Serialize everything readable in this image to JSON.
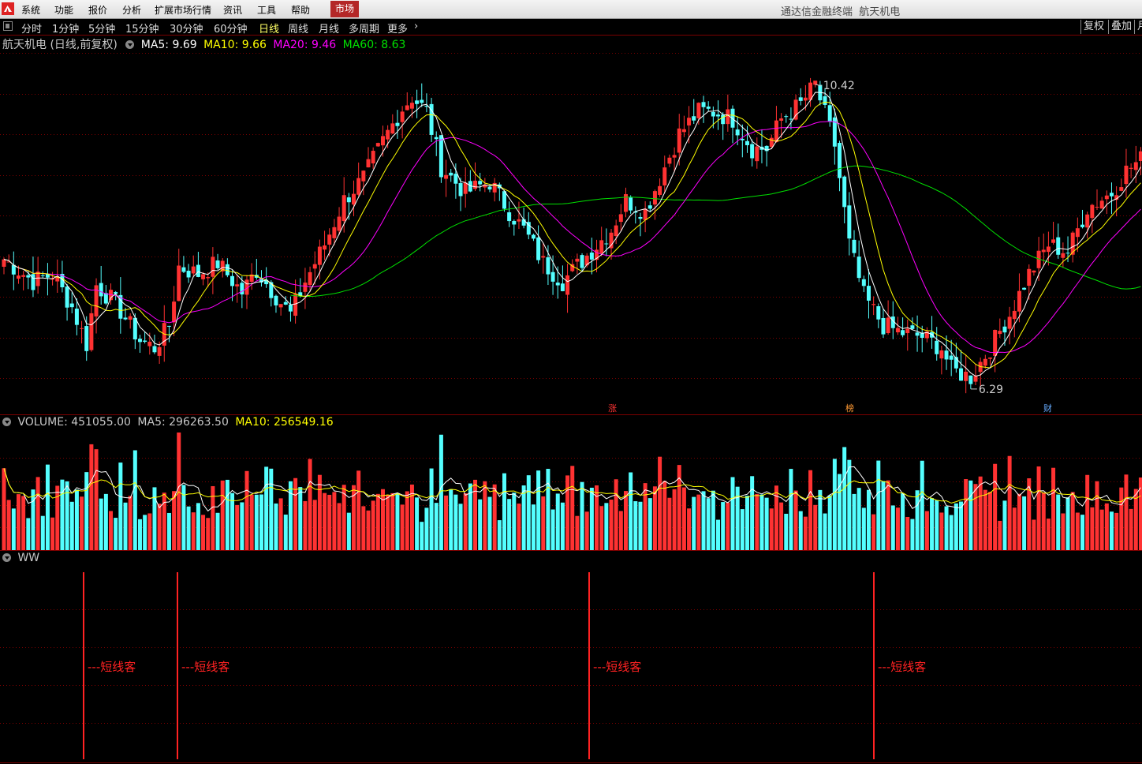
{
  "window": {
    "title": "通达信金融终端",
    "stock_name": "航天机电"
  },
  "menu": {
    "items": [
      "系统",
      "功能",
      "报价",
      "分析",
      "扩展市场行情",
      "资讯",
      "工具",
      "帮助"
    ],
    "active": "市场"
  },
  "period_tabs": {
    "items": [
      "分时",
      "1分钟",
      "5分钟",
      "15分钟",
      "30分钟",
      "60分钟",
      "日线",
      "周线",
      "月线",
      "多周期",
      "更多"
    ],
    "active_index": 6,
    "more_arrow": "›"
  },
  "right_buttons": {
    "items": [
      "复权",
      "叠加",
      "月"
    ]
  },
  "price_panel": {
    "title": "航天机电 (日线,前复权)",
    "ma_labels": [
      {
        "label": "MA5: 9.69",
        "color": "#ffffff"
      },
      {
        "label": "MA10: 9.66",
        "color": "#ffff00"
      },
      {
        "label": "MA20: 9.46",
        "color": "#ff00ff"
      },
      {
        "label": "MA60: 8.63",
        "color": "#00e000"
      }
    ],
    "high_label": "10.42",
    "low_label": "6.29",
    "event_flags": [
      {
        "label": "涨",
        "color": "#ff3333"
      },
      {
        "label": "榜",
        "color": "#ff9933"
      },
      {
        "label": "财",
        "color": "#66aaff"
      }
    ]
  },
  "volume_panel": {
    "labels": [
      {
        "label": "VOLUME: 451055.00",
        "color": "#c8c8c8"
      },
      {
        "label": "MA5: 296263.50",
        "color": "#c8c8c8"
      },
      {
        "label": "MA10: 256549.16",
        "color": "#ffff00"
      }
    ]
  },
  "ww_panel": {
    "label": "WW",
    "signal_text": "---短线客",
    "signal_count": 4
  },
  "colors": {
    "up": "#ff3232",
    "down": "#54ffff",
    "grid": "#7a0000",
    "ma5": "#ffffff",
    "ma10": "#ffff00",
    "ma20": "#ff00ff",
    "ma60": "#00e000"
  },
  "chart_data": {
    "type": "candlestick",
    "series_anchors_close": [
      [
        0,
        8.05
      ],
      [
        6,
        7.75
      ],
      [
        10,
        7.85
      ],
      [
        14,
        7.4
      ],
      [
        17,
        6.9
      ],
      [
        19,
        7.7
      ],
      [
        23,
        7.45
      ],
      [
        28,
        6.95
      ],
      [
        31,
        6.85
      ],
      [
        34,
        7.15
      ],
      [
        36,
        7.95
      ],
      [
        40,
        7.85
      ],
      [
        44,
        8.0
      ],
      [
        49,
        7.6
      ],
      [
        52,
        7.9
      ],
      [
        56,
        7.55
      ],
      [
        59,
        7.3
      ],
      [
        62,
        7.75
      ],
      [
        66,
        8.25
      ],
      [
        70,
        8.85
      ],
      [
        74,
        9.15
      ],
      [
        78,
        9.65
      ],
      [
        82,
        10.1
      ],
      [
        84,
        10.25
      ],
      [
        87,
        10.05
      ],
      [
        90,
        9.3
      ],
      [
        95,
        8.95
      ],
      [
        100,
        9.1
      ],
      [
        104,
        8.7
      ],
      [
        107,
        8.45
      ],
      [
        111,
        8.0
      ],
      [
        115,
        7.75
      ],
      [
        120,
        8.1
      ],
      [
        125,
        8.45
      ],
      [
        128,
        8.85
      ],
      [
        132,
        8.7
      ],
      [
        136,
        9.3
      ],
      [
        139,
        9.75
      ],
      [
        143,
        10.05
      ],
      [
        146,
        10.05
      ],
      [
        150,
        9.95
      ],
      [
        154,
        9.55
      ],
      [
        157,
        9.55
      ],
      [
        160,
        9.95
      ],
      [
        164,
        10.15
      ],
      [
        167,
        10.42
      ],
      [
        171,
        9.6
      ],
      [
        174,
        8.25
      ],
      [
        177,
        7.55
      ],
      [
        181,
        7.15
      ],
      [
        185,
        7.05
      ],
      [
        189,
        7.0
      ],
      [
        193,
        6.85
      ],
      [
        195,
        6.55
      ],
      [
        199,
        6.45
      ],
      [
        203,
        6.85
      ],
      [
        207,
        7.3
      ],
      [
        211,
        7.85
      ],
      [
        215,
        8.25
      ],
      [
        219,
        8.15
      ],
      [
        223,
        8.75
      ],
      [
        228,
        8.95
      ],
      [
        231,
        9.25
      ],
      [
        234,
        9.4
      ]
    ],
    "high": 10.42,
    "low": 6.29,
    "ylim": [
      6.0,
      10.9
    ]
  }
}
